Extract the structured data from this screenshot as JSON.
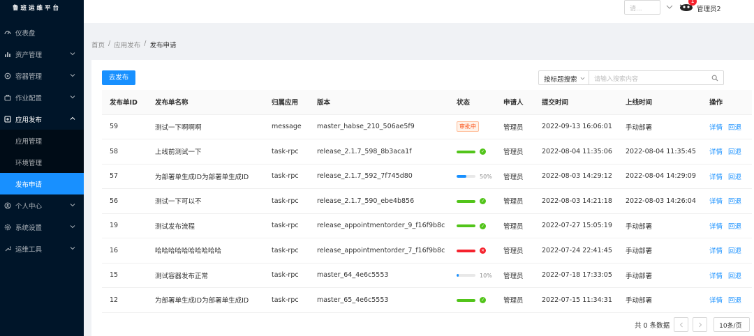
{
  "app": {
    "brand": "鲁班运维平台"
  },
  "sidebar": {
    "items": [
      {
        "label": "仪表盘",
        "icon": "dashboard-icon"
      },
      {
        "label": "资产管理",
        "icon": "asset-icon"
      },
      {
        "label": "容器管理",
        "icon": "container-icon"
      },
      {
        "label": "作业配置",
        "icon": "job-icon"
      },
      {
        "label": "应用发布",
        "icon": "release-icon"
      },
      {
        "label": "个人中心",
        "icon": "user-icon"
      },
      {
        "label": "系统设置",
        "icon": "settings-icon"
      },
      {
        "label": "运维工具",
        "icon": "tool-icon"
      }
    ],
    "submenu": [
      {
        "label": "应用管理"
      },
      {
        "label": "环境管理"
      },
      {
        "label": "发布申请"
      }
    ]
  },
  "header": {
    "select_placeholder": "请...",
    "notification_count": "1",
    "username": "管理员2"
  },
  "breadcrumb": [
    "首页",
    "/",
    "应用发布",
    "/",
    "发布申请"
  ],
  "toolbar": {
    "publish_button": "去发布",
    "search_type": "按标题搜索",
    "search_placeholder": "请输入搜索内容"
  },
  "table": {
    "columns": [
      "发布单ID",
      "发布单名称",
      "归属应用",
      "版本",
      "状态",
      "申请人",
      "提交时间",
      "上线时间",
      "操作"
    ],
    "rows": [
      {
        "id": "59",
        "name": "测试一下啊啊啊",
        "app": "message",
        "version": "master_habse_210_506ae5f9",
        "status_kind": "tag",
        "status_text": "审批中",
        "applicant": "管理员",
        "submitted": "2022-09-13 16:06:01",
        "online": "手动部署",
        "detail": "详情",
        "rollback": "回退"
      },
      {
        "id": "58",
        "name": "上线前测试一下",
        "app": "task-rpc",
        "version": "release_2.1.7_598_8b3aca1f",
        "status_kind": "success",
        "progress": 1.0,
        "status_color": "#52c41a",
        "applicant": "管理员",
        "submitted": "2022-08-04 11:35:06",
        "online": "2022-08-04 11:35:45",
        "detail": "详情",
        "rollback": "回退"
      },
      {
        "id": "57",
        "name": "为部署单生成ID为部署单生成ID",
        "app": "task-rpc",
        "version": "release_2.1.7_592_7f745d80",
        "status_kind": "percent",
        "progress": 0.5,
        "status_color": "#1890ff",
        "status_text": "50%",
        "applicant": "管理员",
        "submitted": "2022-08-03 14:29:12",
        "online": "2022-08-04 14:29:09",
        "detail": "详情",
        "rollback": "回退"
      },
      {
        "id": "56",
        "name": "测试一下可以不",
        "app": "task-rpc",
        "version": "release_2.1.7_590_ebe4b856",
        "status_kind": "success",
        "progress": 1.0,
        "status_color": "#52c41a",
        "applicant": "管理员",
        "submitted": "2022-08-03 14:21:18",
        "online": "2022-08-03 14:26:04",
        "detail": "详情",
        "rollback": "回退"
      },
      {
        "id": "19",
        "name": "测试发布流程",
        "app": "task-rpc",
        "version": "release_appointmentorder_9_f16f9b8c",
        "status_kind": "success",
        "progress": 1.0,
        "status_color": "#52c41a",
        "applicant": "管理员",
        "submitted": "2022-07-27 15:05:19",
        "online": "手动部署",
        "detail": "详情",
        "rollback": "回退"
      },
      {
        "id": "16",
        "name": "哈哈哈哈哈哈哈哈哈哈",
        "app": "task-rpc",
        "version": "release_appointmentorder_7_f16f9b8c",
        "status_kind": "error",
        "progress": 1.0,
        "status_color": "#f5222d",
        "applicant": "管理员",
        "submitted": "2022-07-24 22:41:45",
        "online": "手动部署",
        "detail": "详情",
        "rollback": "回退"
      },
      {
        "id": "15",
        "name": "测试容器发布正常",
        "app": "task-rpc",
        "version": "master_64_4e6c5553",
        "status_kind": "percent",
        "progress": 0.1,
        "status_color": "#1890ff",
        "status_text": "10%",
        "applicant": "管理员",
        "submitted": "2022-07-18 17:33:05",
        "online": "手动部署",
        "detail": "详情",
        "rollback": "回退"
      },
      {
        "id": "12",
        "name": "为部署单生成ID为部署单生成ID",
        "app": "task-rpc",
        "version": "master_65_4e6c5553",
        "status_kind": "success",
        "progress": 1.0,
        "status_color": "#52c41a",
        "applicant": "管理员",
        "submitted": "2022-07-15 11:34:31",
        "online": "手动部署",
        "detail": "详情",
        "rollback": "回退"
      }
    ]
  },
  "pagination": {
    "total": "共 0 条数据",
    "page_size": "10条/页"
  }
}
